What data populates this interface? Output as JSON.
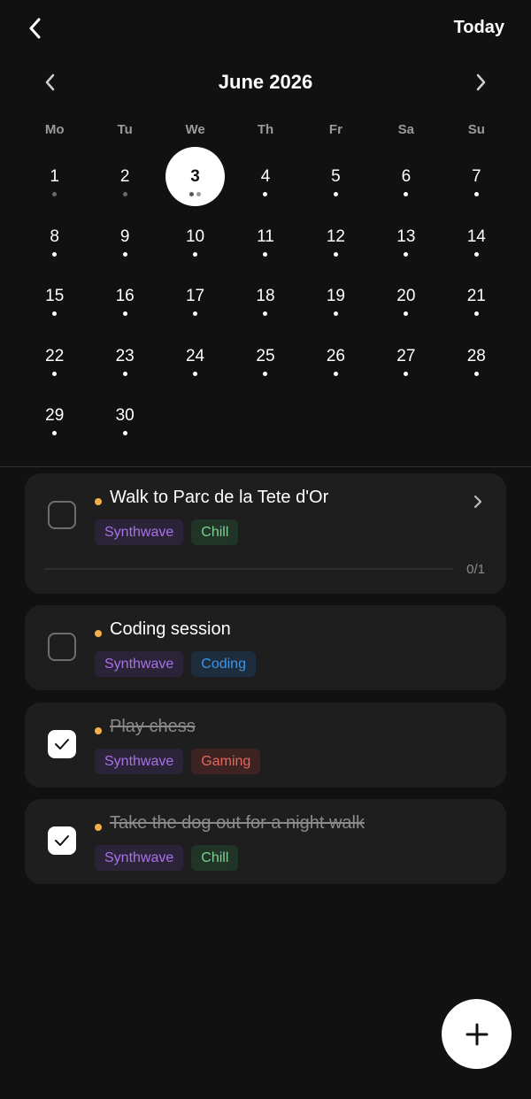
{
  "header": {
    "back_icon": "chevron-left-icon",
    "today_label": "Today"
  },
  "calendar": {
    "month_title": "June 2026",
    "prev_icon": "chevron-left-icon",
    "next_icon": "chevron-right-icon",
    "weekdays": [
      "Mo",
      "Tu",
      "We",
      "Th",
      "Fr",
      "Sa",
      "Su"
    ],
    "selected_day": "3",
    "days": [
      {
        "n": "1",
        "dots": [
          "dim"
        ]
      },
      {
        "n": "2",
        "dots": [
          "dim"
        ]
      },
      {
        "n": "3",
        "dots": [
          "dark",
          "light"
        ]
      },
      {
        "n": "4",
        "dots": [
          "on"
        ]
      },
      {
        "n": "5",
        "dots": [
          "on"
        ]
      },
      {
        "n": "6",
        "dots": [
          "on"
        ]
      },
      {
        "n": "7",
        "dots": [
          "on"
        ]
      },
      {
        "n": "8",
        "dots": [
          "on"
        ]
      },
      {
        "n": "9",
        "dots": [
          "on"
        ]
      },
      {
        "n": "10",
        "dots": [
          "on"
        ]
      },
      {
        "n": "11",
        "dots": [
          "on"
        ]
      },
      {
        "n": "12",
        "dots": [
          "on"
        ]
      },
      {
        "n": "13",
        "dots": [
          "on"
        ]
      },
      {
        "n": "14",
        "dots": [
          "on"
        ]
      },
      {
        "n": "15",
        "dots": [
          "on"
        ]
      },
      {
        "n": "16",
        "dots": [
          "on"
        ]
      },
      {
        "n": "17",
        "dots": [
          "on"
        ]
      },
      {
        "n": "18",
        "dots": [
          "on"
        ]
      },
      {
        "n": "19",
        "dots": [
          "on"
        ]
      },
      {
        "n": "20",
        "dots": [
          "on"
        ]
      },
      {
        "n": "21",
        "dots": [
          "on"
        ]
      },
      {
        "n": "22",
        "dots": [
          "on"
        ]
      },
      {
        "n": "23",
        "dots": [
          "on"
        ]
      },
      {
        "n": "24",
        "dots": [
          "on"
        ]
      },
      {
        "n": "25",
        "dots": [
          "on"
        ]
      },
      {
        "n": "26",
        "dots": [
          "on"
        ]
      },
      {
        "n": "27",
        "dots": [
          "on"
        ]
      },
      {
        "n": "28",
        "dots": [
          "on"
        ]
      },
      {
        "n": "29",
        "dots": [
          "on"
        ]
      },
      {
        "n": "30",
        "dots": [
          "on"
        ]
      }
    ]
  },
  "tasks": [
    {
      "title": "Walk to Parc de la Tete d'Or",
      "done": false,
      "tags": [
        {
          "label": "Synthwave",
          "kind": "synthwave"
        },
        {
          "label": "Chill",
          "kind": "chill"
        }
      ],
      "subtasks_label": "0/1",
      "subtasks_progress": 0
    },
    {
      "title": "Coding session",
      "done": false,
      "tags": [
        {
          "label": "Synthwave",
          "kind": "synthwave"
        },
        {
          "label": "Coding",
          "kind": "coding"
        }
      ]
    },
    {
      "title": "Play chess",
      "done": true,
      "tags": [
        {
          "label": "Synthwave",
          "kind": "synthwave"
        },
        {
          "label": "Gaming",
          "kind": "gaming"
        }
      ]
    },
    {
      "title": "Take the dog out for a night walk",
      "done": true,
      "tags": [
        {
          "label": "Synthwave",
          "kind": "synthwave"
        },
        {
          "label": "Chill",
          "kind": "chill"
        }
      ]
    }
  ],
  "colors": {
    "background": "#111111",
    "card": "#1e1e1e",
    "priority_dot": "#f5b04a",
    "tag_synthwave": "#a970e8",
    "tag_chill": "#7fd08e",
    "tag_coding": "#3d95e8",
    "tag_gaming": "#e8675d"
  },
  "fab": {
    "icon": "plus-icon"
  }
}
